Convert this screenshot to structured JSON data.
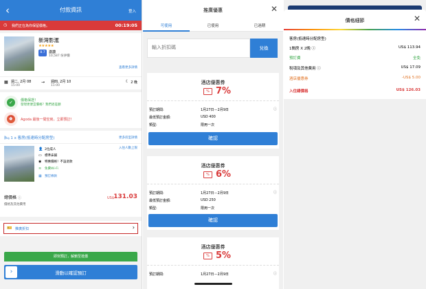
{
  "booking": {
    "header_title": "付款資訊",
    "login": "登入",
    "timer_msg": "我們正在為你保留價格。",
    "timer": "00:19:05",
    "hotel_name": "新灣影滙",
    "stars": "★★★★★",
    "score": "8.7",
    "score_word": "激讚",
    "reviews": "10,587 份評價",
    "see_details": "查看更多詳情",
    "checkin_date": "週二, 2月 08",
    "checkin_time": "15:00",
    "checkout_date": "週四, 2月 10",
    "checkout_time": "11:00",
    "nights": "2 晚",
    "guarantee_title": "價格保證！",
    "guarantee_sub": "發現更便宜價格？我們退差額",
    "last_room": "Agoda 最後一間空房，立即預訂！",
    "room_head": "1 x 客房(抵達時分配房型)",
    "room_more": "更多房型詳情",
    "occupancy_link": "入住人數上限",
    "features": [
      {
        "icon": "adults-icon",
        "glyph": "👤",
        "text": "2位成人",
        "style": "plain"
      },
      {
        "icon": "bed-icon",
        "glyph": "▭",
        "text": "標準床鋪",
        "style": "plain"
      },
      {
        "icon": "deal-icon",
        "glyph": "◉",
        "text": "特惠價格！不設退款",
        "style": "plain"
      },
      {
        "icon": "wifi-icon",
        "glyph": "≋",
        "text": "免費Wi-Fi",
        "style": "green"
      },
      {
        "icon": "room-info-icon",
        "glyph": "▦",
        "text": "預訂條款",
        "style": "blue"
      }
    ],
    "total_label": "總價格",
    "total_sub": "價格及其他費用",
    "total_currency": "US$",
    "total_value": "131.03",
    "promo_label": "推廣折扣",
    "book_banner": "即刻預訂，解鎖至抵價",
    "slide_label": "滑動以確認預訂"
  },
  "coupons": {
    "title": "推廣優惠",
    "tabs": [
      "可使用",
      "已使用",
      "已過期"
    ],
    "placeholder": "輸入折扣碼",
    "redeem": "兌換",
    "labels": {
      "period": "預訂期間:",
      "min": "最低預訂金額:",
      "type": "類型:"
    },
    "items": [
      {
        "title": "酒店優惠券",
        "pct": "7%",
        "period": "1月27日－2月9日",
        "min": "USD 400",
        "type": "限用一次",
        "confirm": "確認"
      },
      {
        "title": "酒店優惠券",
        "pct": "6%",
        "period": "1月27日－2月9日",
        "min": "USD 250",
        "type": "限用一次",
        "confirm": "確認"
      },
      {
        "title": "酒店優惠券",
        "pct": "5%",
        "period": "1月27日－2月9日"
      }
    ]
  },
  "breakdown": {
    "title": "價格細節",
    "rows": [
      {
        "label": "客房(抵達時分配房型)",
        "value": "",
        "color": "#222222",
        "bold": false
      },
      {
        "label": "1間房 X 2晚 ⓘ",
        "value": "US$ 113.94",
        "color": "#222222",
        "bold": false
      },
      {
        "label": "預訂費",
        "value": "全免",
        "color": "#3aa84a",
        "bold": false
      },
      {
        "label": "稅項及其他費用 ⓘ",
        "value": "US$ 17.09",
        "color": "#222222",
        "bold": false
      },
      {
        "label": "酒店優惠券",
        "value": "-US$ 5.00",
        "color": "#e07020",
        "bold": false
      },
      {
        "label": "入住總價格",
        "value": "US$ 126.03",
        "color": "#d93a3a",
        "bold": true
      }
    ]
  },
  "colors": {
    "brand_blue": "#2f7fd6",
    "alert_red": "#d93a3a",
    "success_green": "#3aa84a"
  }
}
